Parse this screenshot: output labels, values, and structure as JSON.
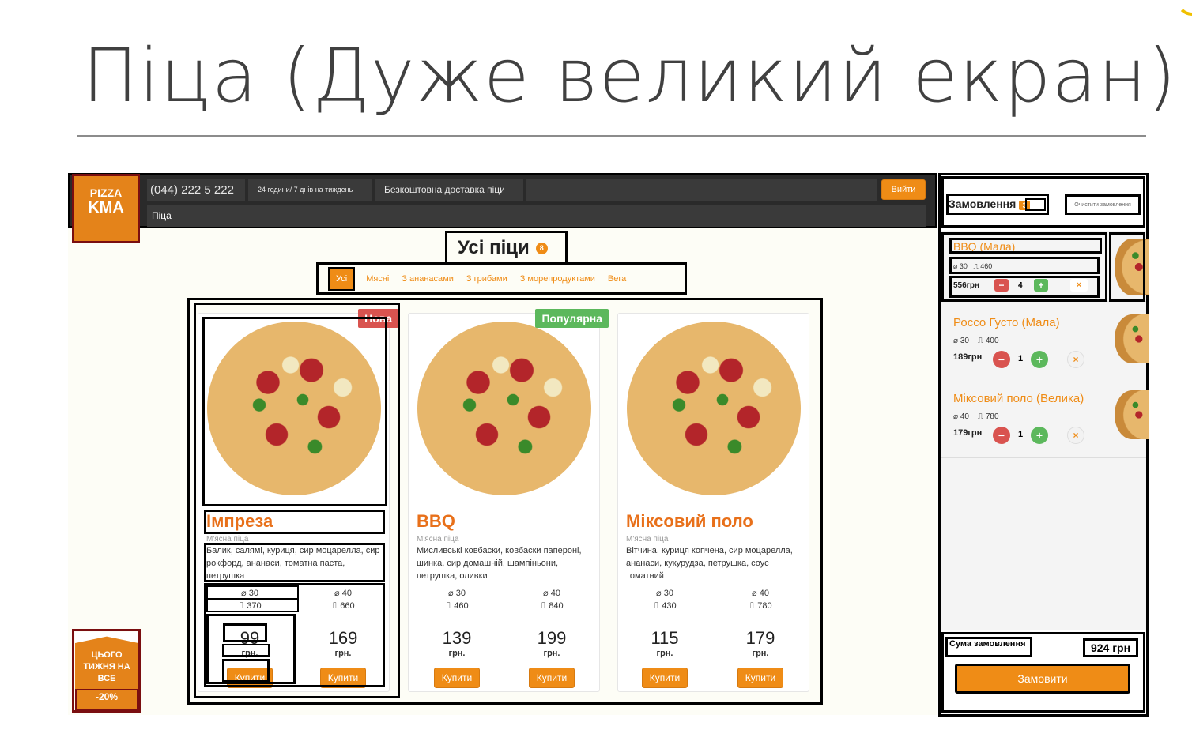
{
  "slide": {
    "title": "Піца (Дуже великий екран)"
  },
  "header": {
    "logo_line1": "PIZZA",
    "logo_line2": "KMA",
    "phone": "(044) 222 5 222",
    "hours": "24 години/ 7 днів на тиждень",
    "delivery": "Безкоштовна доставка піци",
    "login_label": "Вийти",
    "breadcrumb": "Піца"
  },
  "catalog": {
    "title": "Усі піци",
    "count": "8",
    "filters": [
      {
        "label": "Усі"
      },
      {
        "label": "Мясні"
      },
      {
        "label": "З ананасами"
      },
      {
        "label": "З грибами"
      },
      {
        "label": "З морепродуктами"
      },
      {
        "label": "Вега"
      }
    ]
  },
  "products": [
    {
      "badge": "Нова",
      "badge_color": "#d9534f",
      "name": "Імпреза",
      "category": "М'ясна піца",
      "description": "Балик, салямі, куриця, сир моцарелла, сир рокфорд, ананаси, томатна паста, петрушка",
      "small": {
        "diameter": "⌀ 30",
        "weight": "370",
        "price": "99",
        "currency": "грн.",
        "buy": "Купити"
      },
      "big": {
        "diameter": "⌀ 40",
        "weight": "660",
        "price": "169",
        "currency": "грн.",
        "buy": "Купити"
      }
    },
    {
      "badge": "Популярна",
      "badge_color": "#5cb85c",
      "name": "BBQ",
      "category": "М'ясна піца",
      "description": "Мисливські ковбаски, ковбаски папероні, шинка, сир домашній, шампіньони, петрушка, оливки",
      "small": {
        "diameter": "⌀ 30",
        "weight": "460",
        "price": "139",
        "currency": "грн.",
        "buy": "Купити"
      },
      "big": {
        "diameter": "⌀ 40",
        "weight": "840",
        "price": "199",
        "currency": "грн.",
        "buy": "Купити"
      }
    },
    {
      "badge": "",
      "badge_color": "",
      "name": "Міксовий поло",
      "category": "М'ясна піца",
      "description": "Вітчина, куриця копчена, сир моцарелла, ананаси, кукурудза, петрушка, соус томатний",
      "small": {
        "diameter": "⌀ 30",
        "weight": "430",
        "price": "115",
        "currency": "грн.",
        "buy": "Купити"
      },
      "big": {
        "diameter": "⌀ 40",
        "weight": "780",
        "price": "179",
        "currency": "грн.",
        "buy": "Купити"
      }
    }
  ],
  "order": {
    "title": "Замовлення",
    "count": "3",
    "clear_label": "Очистити замовлення",
    "items": [
      {
        "name": "BBQ (Мала)",
        "diameter": "30",
        "weight": "460",
        "price": "556грн",
        "qty": "4"
      },
      {
        "name": "Россо Густо (Мала)",
        "diameter": "30",
        "weight": "400",
        "price": "189грн",
        "qty": "1"
      },
      {
        "name": "Міксовий поло (Велика)",
        "diameter": "40",
        "weight": "780",
        "price": "179грн",
        "qty": "1"
      }
    ],
    "sum_label": "Сума замовлення",
    "sum_value": "924 грн",
    "submit_label": "Замовити"
  },
  "promo": {
    "text": "ЦЬОГО ТИЖНЯ НА ВСЕ",
    "discount": "-20%"
  },
  "icons": {
    "minus": "minus-icon",
    "plus": "plus-icon",
    "remove": "close-icon",
    "diameter": "diameter-icon",
    "weight": "weight-icon"
  },
  "colors": {
    "accent": "#ef8c16",
    "red": "#d9534f",
    "green": "#5cb85c",
    "header": "#2a2a2a"
  }
}
